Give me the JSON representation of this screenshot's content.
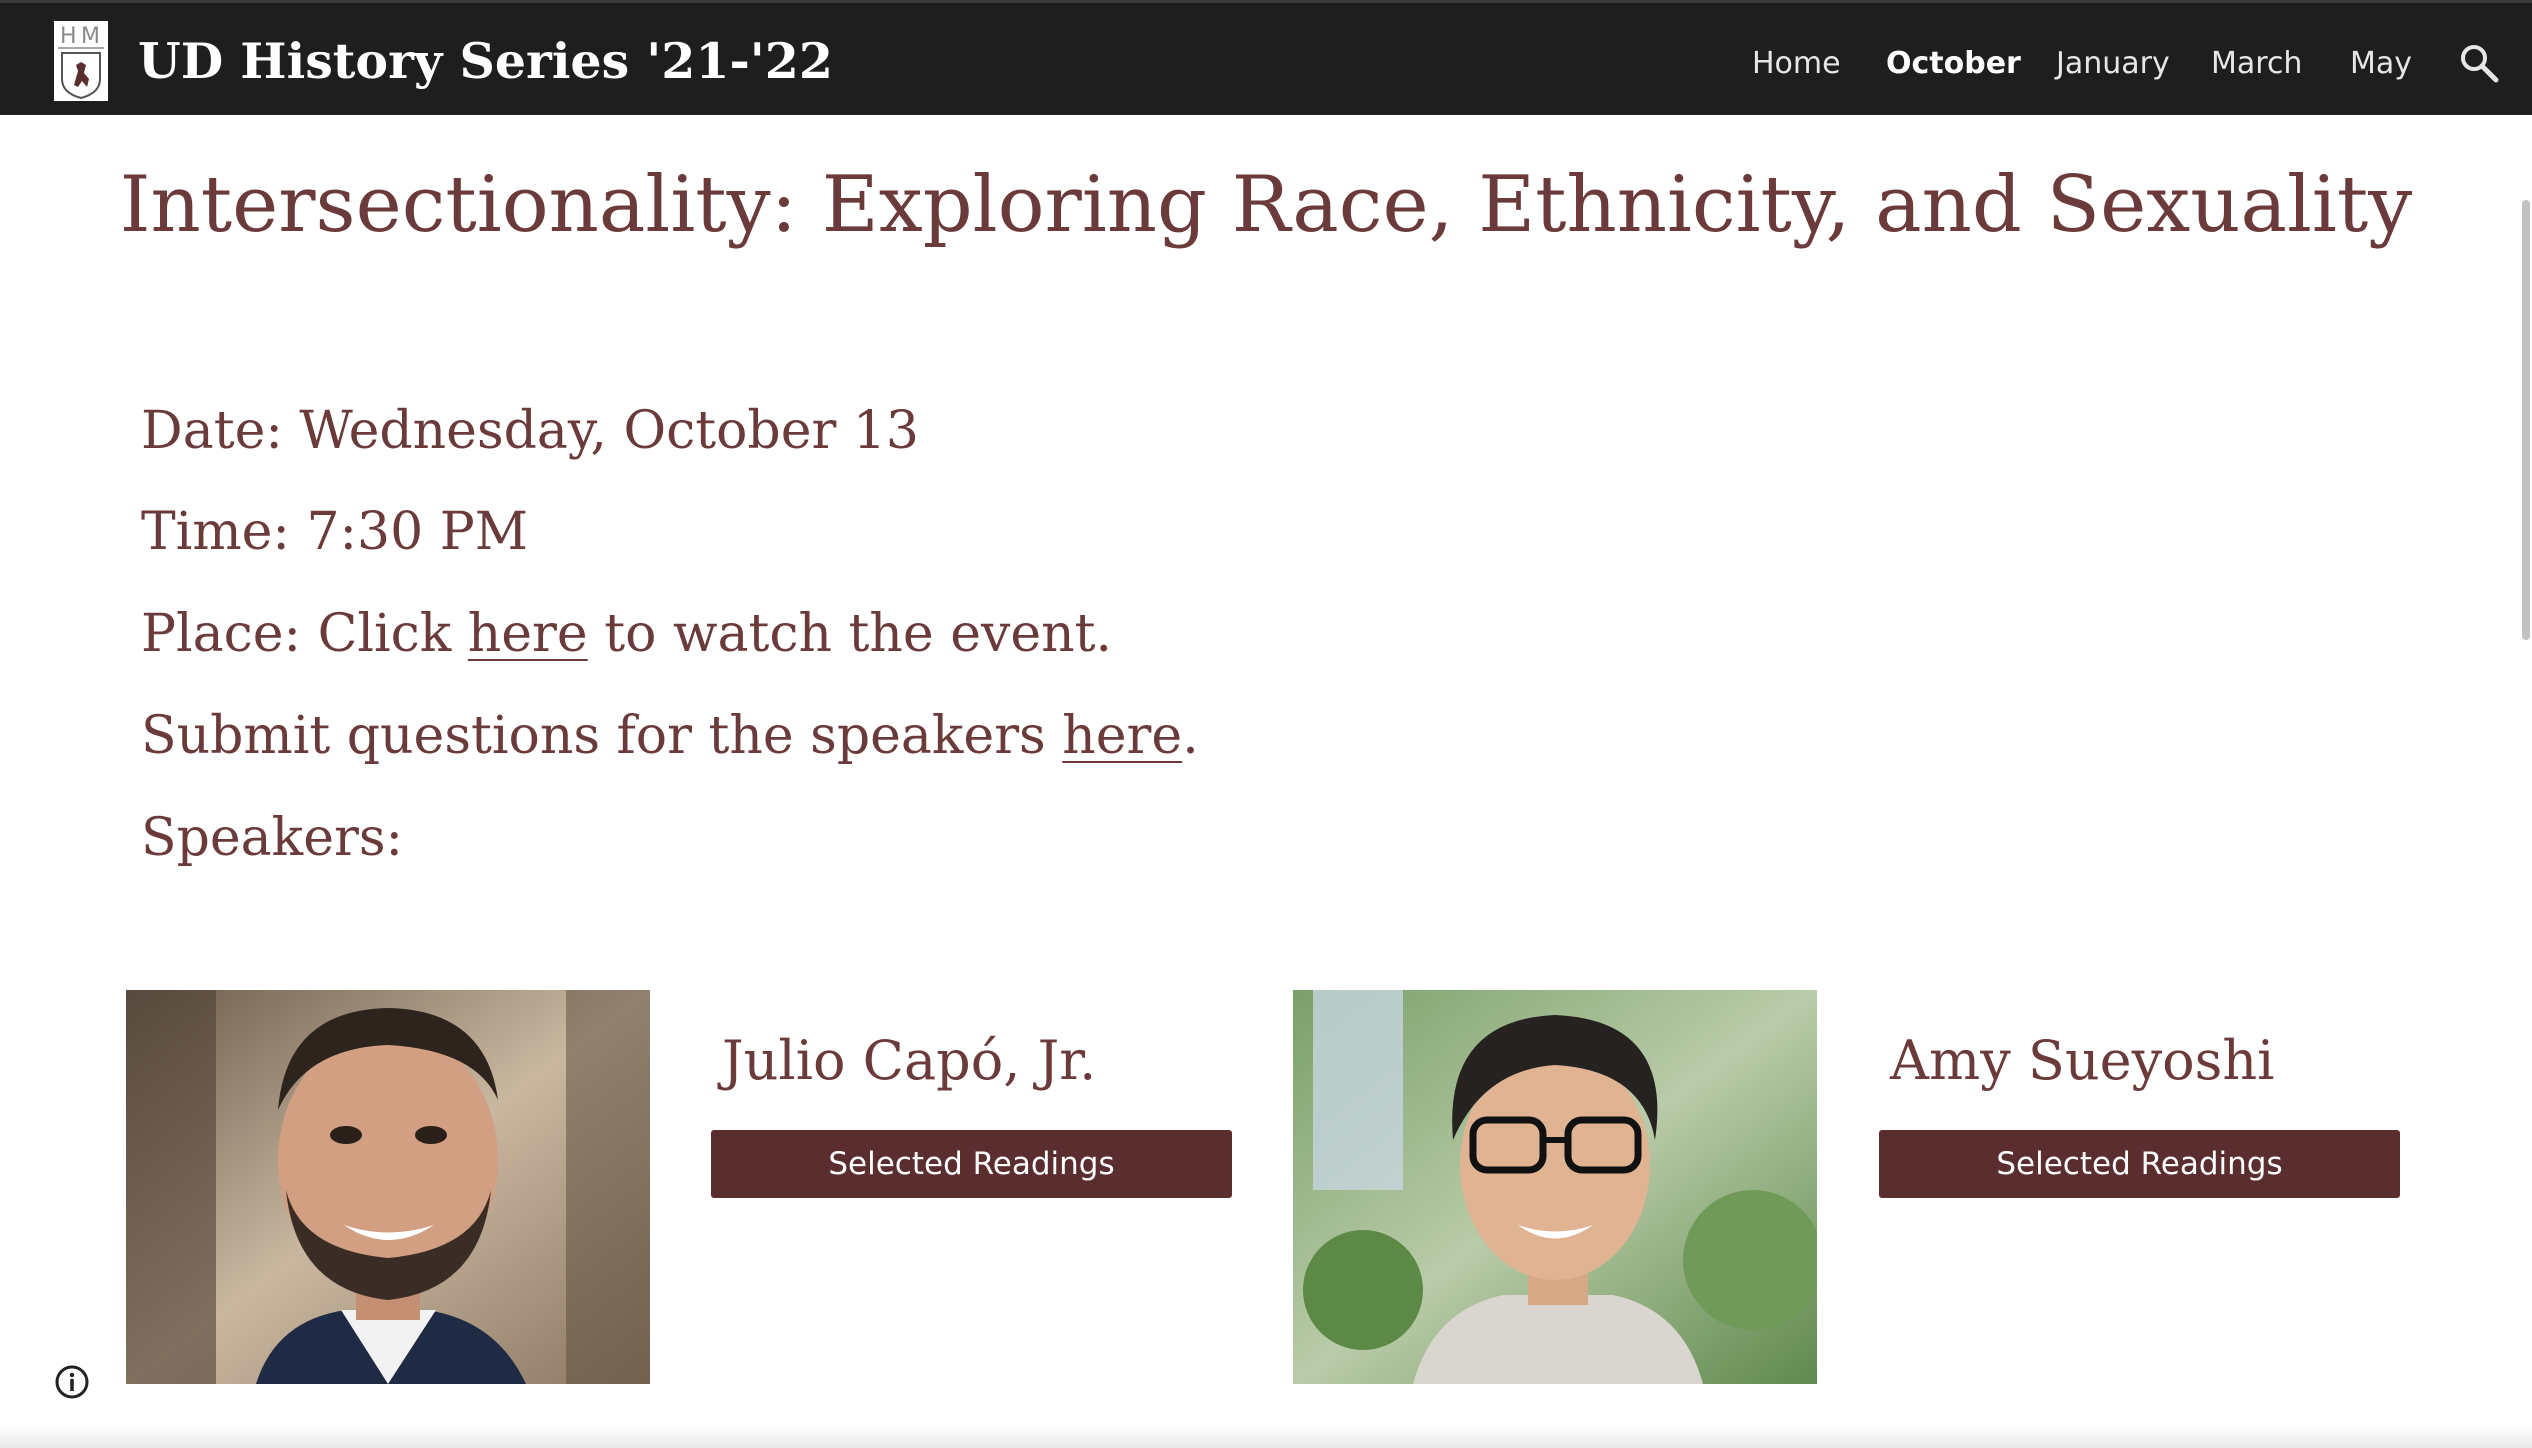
{
  "header": {
    "site_title": "UD History Series '21-'22",
    "nav": [
      {
        "label": "Home",
        "active": false
      },
      {
        "label": "October",
        "active": true
      },
      {
        "label": "January",
        "active": false
      },
      {
        "label": "March",
        "active": false
      },
      {
        "label": "May",
        "active": false
      }
    ],
    "search_icon": "search-icon",
    "logo_icon": "hm-shield-logo"
  },
  "main": {
    "title": "Intersectionality: Exploring Race, Ethnicity, and Sexuality",
    "date_line": "Date: Wednesday, October 13",
    "time_line": "Time: 7:30 PM",
    "place": {
      "prefix": "Place: Click ",
      "link": "here",
      "suffix": " to watch the event."
    },
    "questions": {
      "prefix": "Submit questions for the speakers ",
      "link": "here",
      "suffix": "."
    },
    "speakers_label": "Speakers:",
    "speakers": [
      {
        "name": "Julio Capó, Jr.",
        "button": "Selected Readings"
      },
      {
        "name": "Amy Sueyoshi",
        "button": "Selected Readings"
      }
    ]
  },
  "footer": {
    "info_icon": "info-icon"
  },
  "colors": {
    "accent": "#6b3a3a",
    "button": "#5a2e2e",
    "header_bg": "#1e1e1e"
  }
}
